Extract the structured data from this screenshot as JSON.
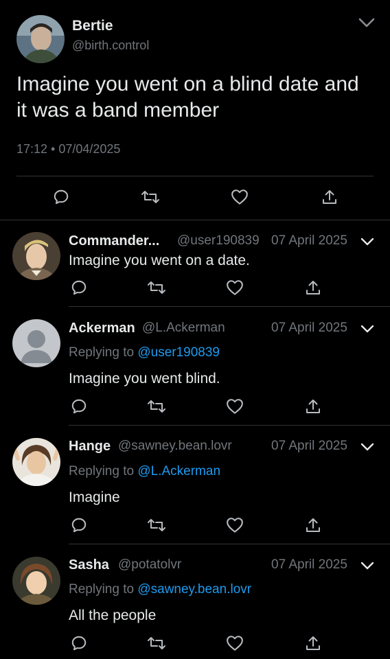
{
  "main_tweet": {
    "author_name": "Bertie",
    "author_handle": "@birth.control",
    "text": "Imagine you went on a blind date and it was a band member",
    "time": "17:12",
    "date": "07/04/2025",
    "meta": "17:12 • 07/04/2025",
    "icons": [
      "reply-icon",
      "retweet-icon",
      "like-icon",
      "share-icon"
    ]
  },
  "replies": [
    {
      "name": "Commander...",
      "handle": "@user190839",
      "date": "07 April 2025",
      "replying_label": "",
      "replying_to": "",
      "text": "Imagine you went on a date."
    },
    {
      "name": "Ackerman",
      "handle": "@L.Ackerman",
      "date": "07 April 2025",
      "replying_label": "Replying to ",
      "replying_to": "@user190839",
      "text": "Imagine you went blind."
    },
    {
      "name": "Hange",
      "handle": "@sawney.bean.lovr",
      "date": "07 April 2025",
      "replying_label": "Replying to ",
      "replying_to": "@L.Ackerman",
      "text": "Imagine"
    },
    {
      "name": "Sasha",
      "handle": "@potatolvr",
      "date": "07 April 2025",
      "replying_label": "Replying to ",
      "replying_to": "@sawney.bean.lovr",
      "text": "All the people"
    }
  ],
  "colors": {
    "background": "#000000",
    "text": "#e7e9ea",
    "muted": "#71767b",
    "link": "#1d9bf0",
    "divider": "#2f3336"
  }
}
